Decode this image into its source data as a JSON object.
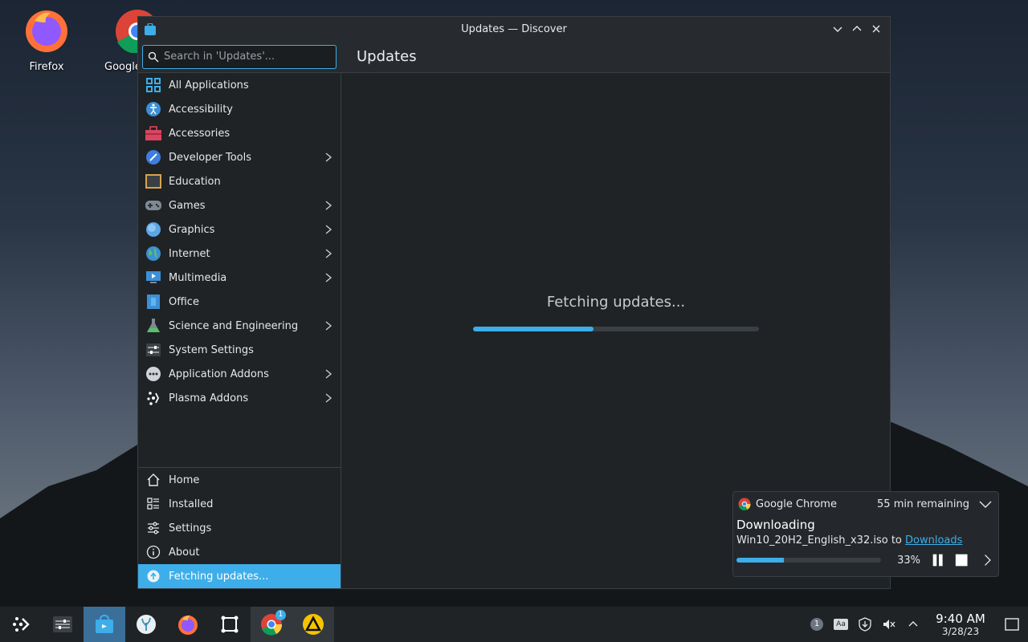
{
  "desktop": {
    "icons": [
      {
        "label": "Firefox"
      },
      {
        "label": "Google"
      }
    ]
  },
  "window": {
    "title": "Updates — Discover",
    "search_placeholder": "Search in 'Updates'...",
    "page_title": "Updates",
    "categories": [
      {
        "label": "All Applications",
        "icon": "grid-icon",
        "has_children": false
      },
      {
        "label": "Accessibility",
        "icon": "accessibility-icon",
        "has_children": false
      },
      {
        "label": "Accessories",
        "icon": "toolbox-icon",
        "has_children": false
      },
      {
        "label": "Developer Tools",
        "icon": "developer-tools-icon",
        "has_children": true
      },
      {
        "label": "Education",
        "icon": "chalkboard-icon",
        "has_children": false
      },
      {
        "label": "Games",
        "icon": "gamepad-icon",
        "has_children": true
      },
      {
        "label": "Graphics",
        "icon": "graphics-icon",
        "has_children": true
      },
      {
        "label": "Internet",
        "icon": "globe-icon",
        "has_children": true
      },
      {
        "label": "Multimedia",
        "icon": "multimedia-icon",
        "has_children": true
      },
      {
        "label": "Office",
        "icon": "office-icon",
        "has_children": false
      },
      {
        "label": "Science and Engineering",
        "icon": "flask-icon",
        "has_children": true
      },
      {
        "label": "System Settings",
        "icon": "system-settings-icon",
        "has_children": false
      },
      {
        "label": "Application Addons",
        "icon": "addons-icon",
        "has_children": true
      },
      {
        "label": "Plasma Addons",
        "icon": "plasma-icon",
        "has_children": true
      }
    ],
    "bottom_nav": [
      {
        "label": "Home",
        "icon": "home-icon"
      },
      {
        "label": "Installed",
        "icon": "installed-icon"
      },
      {
        "label": "Settings",
        "icon": "settings-icon"
      },
      {
        "label": "About",
        "icon": "info-icon"
      },
      {
        "label": "Fetching updates...",
        "icon": "update-icon"
      }
    ],
    "status_text": "Fetching updates...",
    "progress": 0.42
  },
  "notification": {
    "app_name": "Google Chrome",
    "remaining": "55 min remaining",
    "title": "Downloading",
    "file": "Win10_20H2_English_x32.iso to ",
    "link": "Downloads",
    "progress": 0.33,
    "percent": "33%"
  },
  "taskbar": {
    "chrome_badge": "1",
    "tray_badge": "1",
    "tray_font_label": "Aa",
    "time": "9:40 AM",
    "date": "3/28/23"
  },
  "colors": {
    "accent": "#3daee9",
    "window_bg": "#1f2326"
  }
}
